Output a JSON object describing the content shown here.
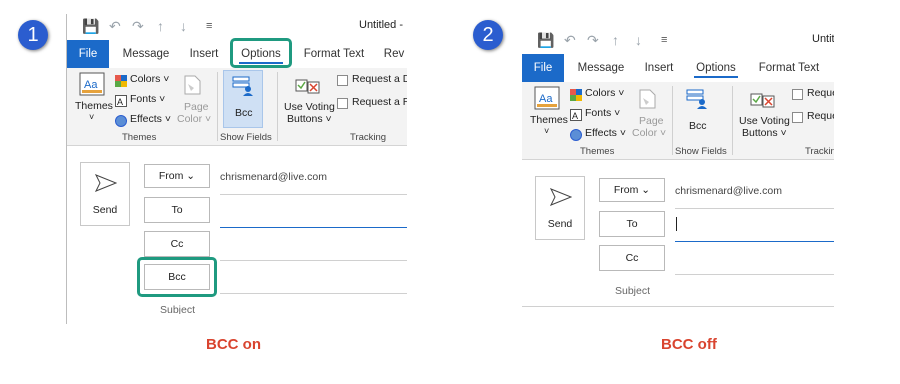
{
  "badges": {
    "one": "1",
    "two": "2"
  },
  "captions": {
    "left": "BCC on",
    "right": "BCC off"
  },
  "left": {
    "title": "Untitled  -",
    "tabs": {
      "file": "File",
      "message": "Message",
      "insert": "Insert",
      "options": "Options",
      "format_text": "Format Text",
      "review": "Rev"
    },
    "themes": {
      "themes_label": "Themes",
      "colors": "Colors ˅",
      "fonts": "Fonts ˅",
      "effects": "Effects ˅",
      "page_color": "Page",
      "page_color2": "Color ˅",
      "group": "Themes"
    },
    "show_fields": {
      "bcc": "Bcc",
      "group": "Show Fields"
    },
    "tracking": {
      "voting1": "Use Voting",
      "voting2": "Buttons ˅",
      "request1": "Request a De",
      "request2": "Request a Re",
      "group": "Tracking"
    },
    "compose": {
      "send": "Send",
      "from": "From",
      "from_address": "chrismenard@live.com",
      "to": "To",
      "cc": "Cc",
      "bcc": "Bcc",
      "subject": "Subject"
    }
  },
  "right": {
    "title": "Untit",
    "tabs": {
      "file": "File",
      "message": "Message",
      "insert": "Insert",
      "options": "Options",
      "format_text": "Format Text"
    },
    "themes": {
      "themes_label": "Themes",
      "colors": "Colors ˅",
      "fonts": "Fonts ˅",
      "effects": "Effects ˅",
      "page_color": "Page",
      "page_color2": "Color ˅",
      "group": "Themes"
    },
    "show_fields": {
      "bcc": "Bcc",
      "group": "Show Fields"
    },
    "tracking": {
      "voting1": "Use Voting",
      "voting2": "Buttons ˅",
      "request1": "Reque",
      "request2": "Reque",
      "group": "Trackin"
    },
    "compose": {
      "send": "Send",
      "from": "From",
      "from_address": "chrismenard@live.com",
      "to": "To",
      "cc": "Cc",
      "subject": "Subject"
    }
  },
  "colors": {
    "accent_blue": "#1b6ac9",
    "highlight_teal": "#1f9a80",
    "caption_red": "#d9442f",
    "badge_blue": "#2b5dcf"
  },
  "icons": [
    "save-icon",
    "undo-icon",
    "redo-icon",
    "up-arrow-icon",
    "down-arrow-icon",
    "customize-qat-icon",
    "themes-icon",
    "colors-icon",
    "fonts-icon",
    "effects-icon",
    "page-color-icon",
    "bcc-icon",
    "voting-buttons-icon",
    "send-icon"
  ]
}
